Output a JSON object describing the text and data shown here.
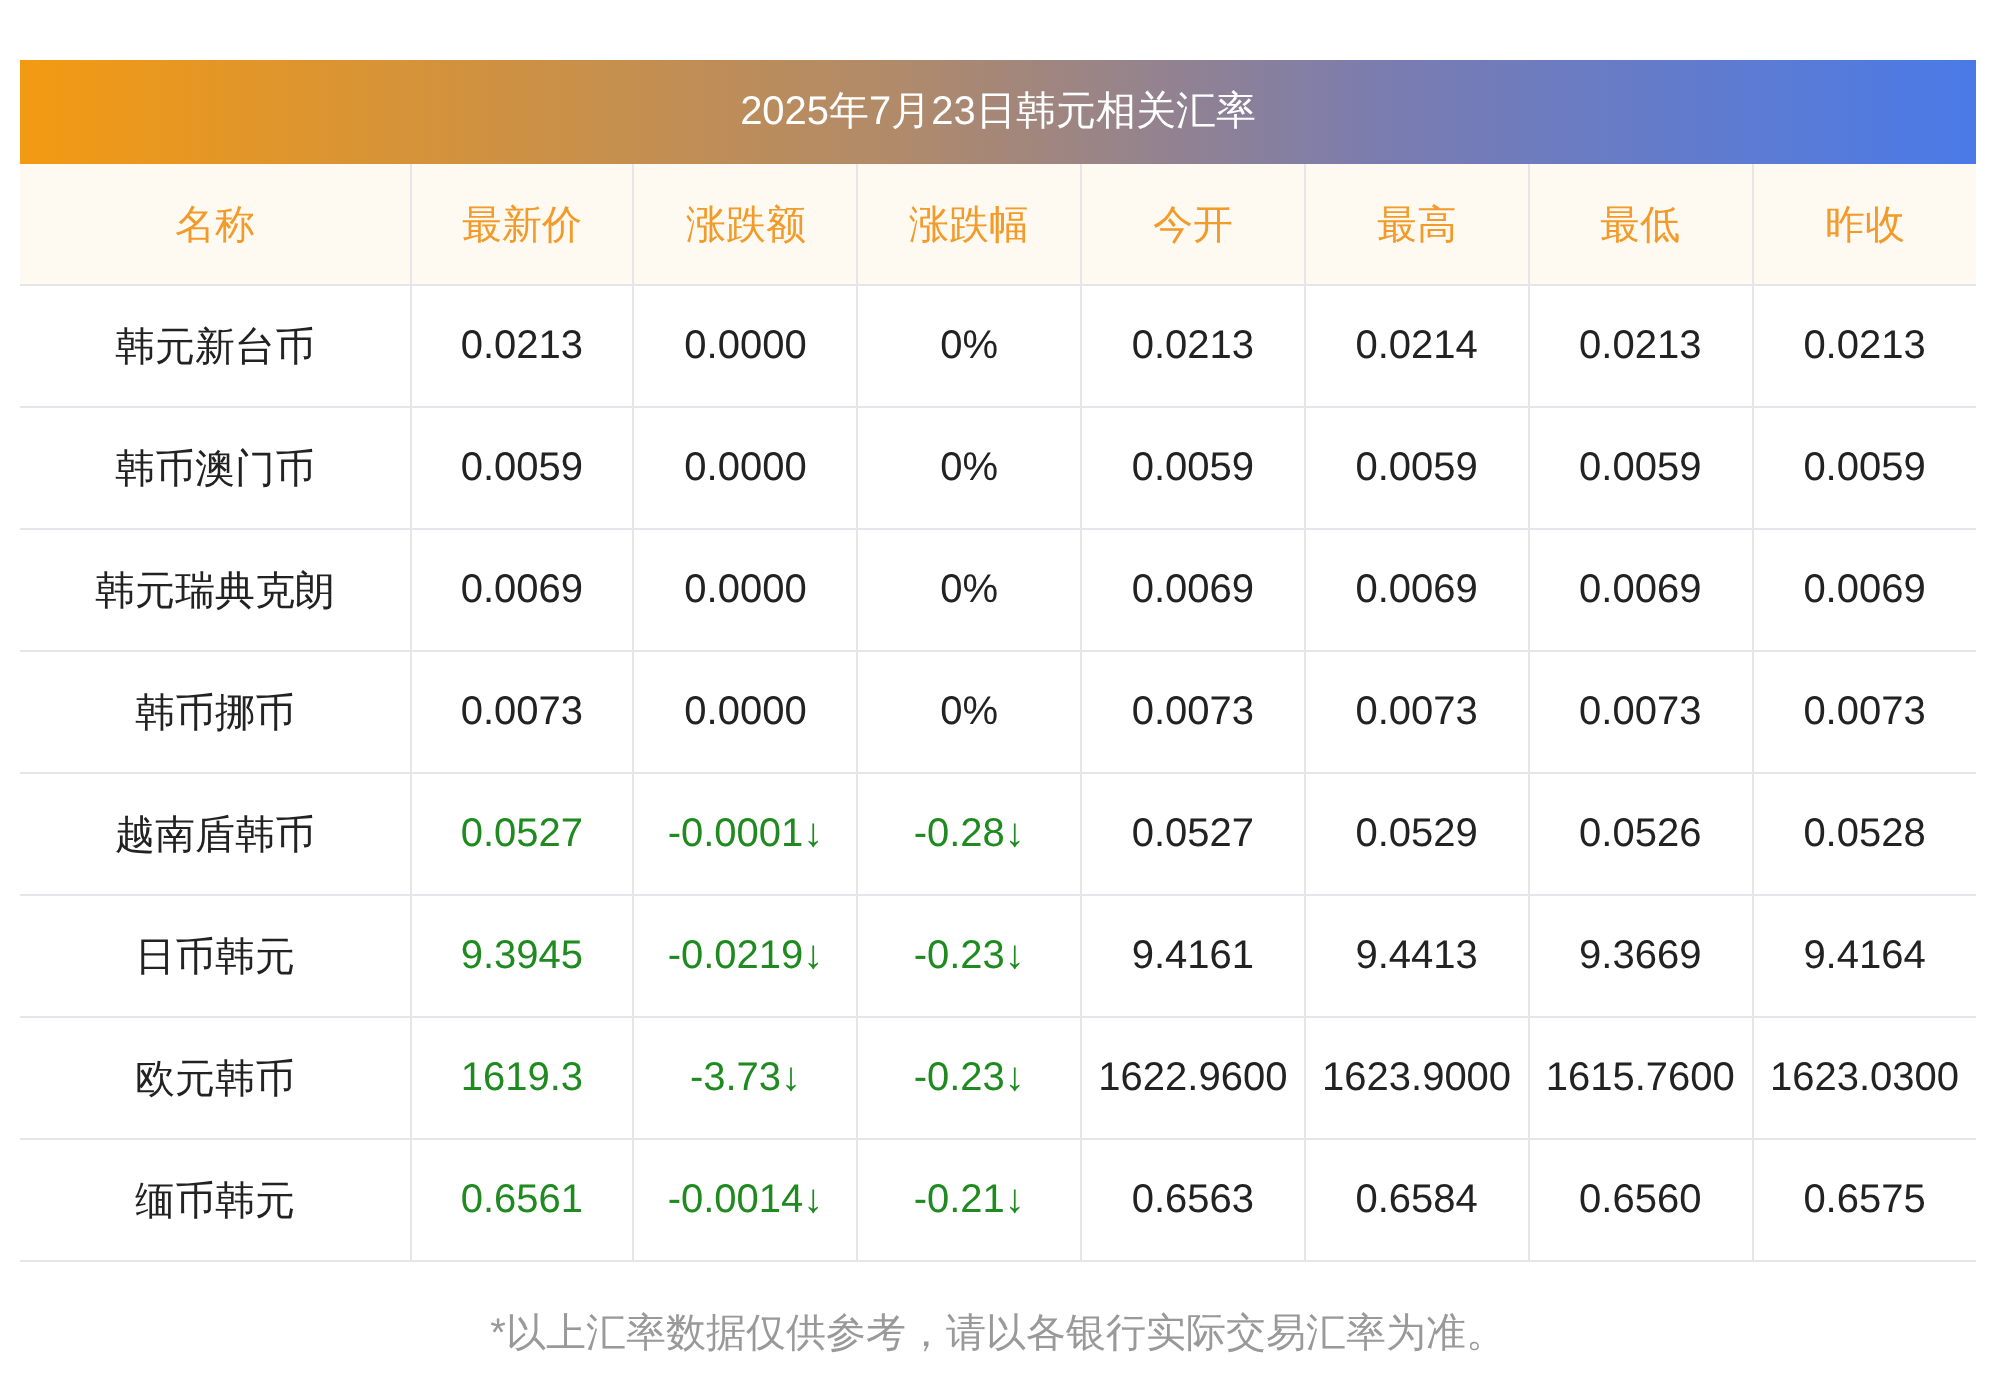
{
  "title": "2025年7月23日韩元相关汇率",
  "columns": [
    "名称",
    "最新价",
    "涨跌额",
    "涨跌幅",
    "今开",
    "最高",
    "最低",
    "昨收"
  ],
  "rows": [
    {
      "falling": false,
      "cells": [
        "韩元新台币",
        "0.0213",
        "0.0000",
        "0%",
        "0.0213",
        "0.0214",
        "0.0213",
        "0.0213"
      ]
    },
    {
      "falling": false,
      "cells": [
        "韩币澳门币",
        "0.0059",
        "0.0000",
        "0%",
        "0.0059",
        "0.0059",
        "0.0059",
        "0.0059"
      ]
    },
    {
      "falling": false,
      "cells": [
        "韩元瑞典克朗",
        "0.0069",
        "0.0000",
        "0%",
        "0.0069",
        "0.0069",
        "0.0069",
        "0.0069"
      ]
    },
    {
      "falling": false,
      "cells": [
        "韩币挪币",
        "0.0073",
        "0.0000",
        "0%",
        "0.0073",
        "0.0073",
        "0.0073",
        "0.0073"
      ]
    },
    {
      "falling": true,
      "cells": [
        "越南盾韩币",
        "0.0527",
        "-0.0001↓",
        "-0.28↓",
        "0.0527",
        "0.0529",
        "0.0526",
        "0.0528"
      ]
    },
    {
      "falling": true,
      "cells": [
        "日币韩元",
        "9.3945",
        "-0.0219↓",
        "-0.23↓",
        "9.4161",
        "9.4413",
        "9.3669",
        "9.4164"
      ]
    },
    {
      "falling": true,
      "cells": [
        "欧元韩币",
        "1619.3",
        "-3.73↓",
        "-0.23↓",
        "1622.9600",
        "1623.9000",
        "1615.7600",
        "1623.0300"
      ]
    },
    {
      "falling": true,
      "cells": [
        "缅币韩元",
        "0.6561",
        "-0.0014↓",
        "-0.21↓",
        "0.6563",
        "0.6584",
        "0.6560",
        "0.6575"
      ]
    }
  ],
  "footnote": "*以上汇率数据仅供参考，请以各银行实际交易汇率为准。"
}
